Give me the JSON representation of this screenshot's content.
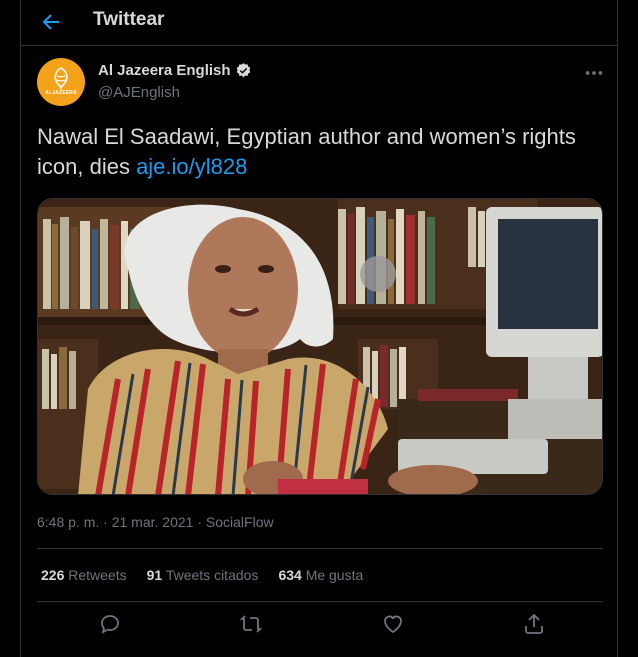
{
  "header": {
    "title": "Twittear"
  },
  "tweet": {
    "author_name": "Al Jazeera English",
    "author_handle": "@AJEnglish",
    "avatar_text": "ALJAZEERA",
    "text": "Nawal El Saadawi, Egyptian author and women’s rights icon, dies ",
    "link": "aje.io/yl828",
    "time": "6:48 p. m.",
    "date": "21 mar. 2021",
    "source": "SocialFlow",
    "separator": "·"
  },
  "stats": {
    "retweets_count": "226",
    "retweets_label": "Retweets",
    "quotes_count": "91",
    "quotes_label": "Tweets citados",
    "likes_count": "634",
    "likes_label": "Me gusta"
  },
  "colors": {
    "accent": "#1d9bf0",
    "avatar": "#f5a21b",
    "muted": "#6e767d"
  },
  "icons": [
    "back-arrow-icon",
    "verified-icon",
    "more-icon",
    "reply-icon",
    "retweet-icon",
    "like-icon",
    "share-icon"
  ]
}
